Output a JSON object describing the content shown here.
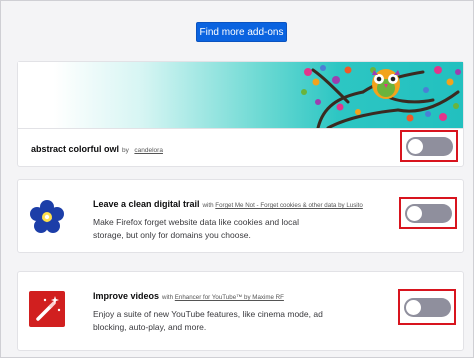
{
  "header": {
    "find_more_label": "Find more add-ons"
  },
  "theme": {
    "name": "abstract colorful owl",
    "by_label": "by",
    "author": "candelora",
    "enabled": false,
    "icon": "owl-tree-artwork"
  },
  "extensions": [
    {
      "title": "Leave a clean digital trail",
      "with_label": "with",
      "addon_name": "Forget Me Not - Forget cookies & other data by Lusito",
      "description": "Make Firefox forget website data like cookies and local storage, but only for domains you choose.",
      "icon": "forget-me-not-flower-icon",
      "enabled": false
    },
    {
      "title": "Improve videos",
      "with_label": "with",
      "addon_name": "Enhancer for YouTube™ by Maxime RF",
      "description": "Enjoy a suite of new YouTube features, like cinema mode, ad blocking, auto-play, and more.",
      "icon": "magic-wand-icon",
      "enabled": false
    }
  ],
  "colors": {
    "primary_button": "#0a63e0",
    "highlight_box": "#d8141e",
    "toggle_off": "#8f8f9d",
    "banner_teal": "#22c0bf"
  }
}
